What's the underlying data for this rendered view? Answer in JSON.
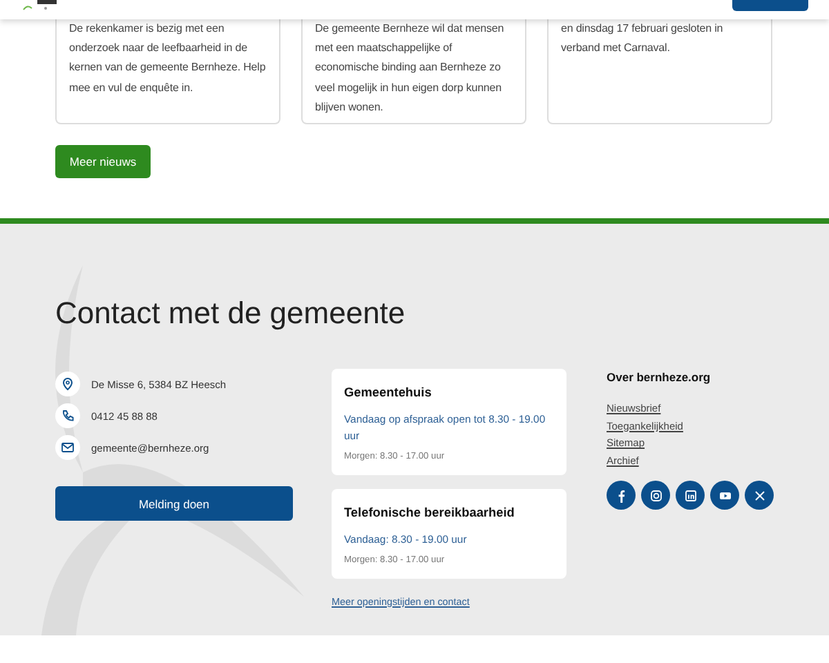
{
  "news_cards": [
    {
      "text": "De rekenkamer is bezig met een onderzoek naar de leefbaarheid in de kernen van de gemeente Bernheze. Help mee en vul de enquête in."
    },
    {
      "text": "De gemeente Bernheze wil dat mensen met een maatschappelijke of economische binding aan Bernheze zo veel mogelijk in hun eigen dorp kunnen blijven wonen."
    },
    {
      "text": "en dinsdag 17 februari gesloten in verband met Carnaval."
    }
  ],
  "more_news_button": "Meer nieuws",
  "footer": {
    "title": "Contact met de gemeente",
    "contact_items": [
      {
        "kind": "address",
        "text": "De Misse 6, 5384 BZ Heesch"
      },
      {
        "kind": "phone",
        "text": "0412 45 88 88"
      },
      {
        "kind": "email",
        "text": "gemeente@bernheze.org"
      }
    ],
    "report_button": "Melding doen",
    "hours_cards": [
      {
        "title": "Gemeentehuis",
        "today": "Vandaag op afspraak open tot 8.30 - 19.00 uur",
        "tomorrow": "Morgen: 8.30 - 17.00 uur"
      },
      {
        "title": "Telefonische bereikbaarheid",
        "today": "Vandaag: 8.30 - 19.00 uur",
        "tomorrow": "Morgen: 8.30 - 17.00 uur"
      }
    ],
    "more_hours_link": "Meer openingstijden en contact",
    "about": {
      "title": "Over bernheze.org",
      "links": [
        "Nieuwsbrief",
        "Toegankelijkheid",
        "Sitemap",
        "Archief"
      ]
    },
    "social": [
      {
        "kind": "facebook"
      },
      {
        "kind": "instagram"
      },
      {
        "kind": "linkedin"
      },
      {
        "kind": "youtube"
      },
      {
        "kind": "x"
      }
    ]
  }
}
